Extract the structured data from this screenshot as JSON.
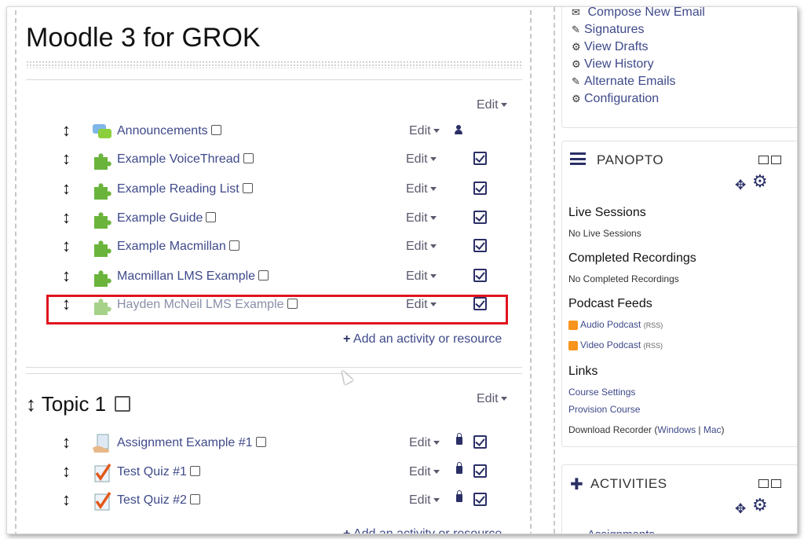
{
  "course": {
    "title": "Moodle 3 for GROK"
  },
  "section0": {
    "edit_label": "Edit",
    "activities": [
      {
        "name": "Announcements",
        "edit": "Edit",
        "status": "person"
      },
      {
        "name": "Example VoiceThread",
        "edit": "Edit",
        "status": "checkbox"
      },
      {
        "name": "Example Reading List",
        "edit": "Edit",
        "status": "checkbox"
      },
      {
        "name": "Example Guide",
        "edit": "Edit",
        "status": "checkbox"
      },
      {
        "name": "Example Macmillan",
        "edit": "Edit",
        "status": "checkbox"
      },
      {
        "name": "Macmillan LMS Example",
        "edit": "Edit",
        "status": "checkbox"
      },
      {
        "name": "Hayden McNeil LMS Example",
        "edit": "Edit",
        "status": "checkbox",
        "dimmed": true,
        "highlighted": true
      }
    ],
    "add_label": "Add an activity or resource"
  },
  "topic1": {
    "title": "Topic 1",
    "edit_label": "Edit",
    "activities": [
      {
        "name": "Assignment Example #1",
        "edit": "Edit"
      },
      {
        "name": "Test Quiz #1",
        "edit": "Edit"
      },
      {
        "name": "Test Quiz #2",
        "edit": "Edit"
      }
    ],
    "add_label": "Add an activity or resource"
  },
  "email_block": {
    "items": [
      "Compose New Email",
      "Signatures",
      "View Drafts",
      "View History",
      "Alternate Emails",
      "Configuration"
    ]
  },
  "panopto": {
    "title": "PANOPTO",
    "live_heading": "Live Sessions",
    "live_text": "No Live Sessions",
    "completed_heading": "Completed Recordings",
    "completed_text": "No Completed Recordings",
    "podcast_heading": "Podcast Feeds",
    "audio_podcast": "Audio Podcast",
    "video_podcast": "Video Podcast",
    "rss": "(RSS)",
    "links_heading": "Links",
    "course_settings": "Course Settings",
    "provision_course": "Provision Course",
    "download_recorder": "Download Recorder (",
    "windows": "Windows",
    "sep": " | ",
    "mac": "Mac",
    "close_paren": ")"
  },
  "activities_block": {
    "title": "ACTIVITIES",
    "first_item": "Assignments"
  },
  "colors": {
    "link": "#3f4a8a",
    "highlight": "#e0141e"
  }
}
